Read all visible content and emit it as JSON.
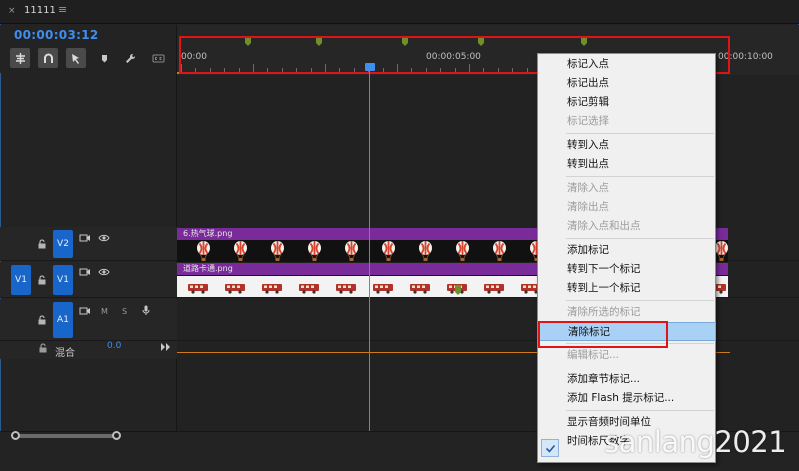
{
  "tab": {
    "close": "×",
    "title": "11111",
    "menu": "≡"
  },
  "timecode": "00:00:03:12",
  "ruler": {
    "labels": [
      "00:00",
      "00:00:05:00",
      "00:00:10:00"
    ]
  },
  "tracks": {
    "v2": {
      "name": "V2",
      "clip": "6.热气球.png"
    },
    "v1": {
      "source": "V1",
      "name": "V1",
      "clip": "道路卡通.png"
    },
    "a1": {
      "name": "A1",
      "mute": "M",
      "solo": "S"
    },
    "mix": {
      "label": "混合",
      "value": "0.0"
    }
  },
  "context_menu": {
    "items": [
      {
        "label": "标记入点",
        "enabled": true
      },
      {
        "label": "标记出点",
        "enabled": true
      },
      {
        "label": "标记剪辑",
        "enabled": true
      },
      {
        "label": "标记选择",
        "enabled": false
      },
      {
        "label": "转到入点",
        "enabled": true
      },
      {
        "label": "转到出点",
        "enabled": true
      },
      {
        "label": "清除入点",
        "enabled": false
      },
      {
        "label": "清除出点",
        "enabled": false
      },
      {
        "label": "清除入点和出点",
        "enabled": false
      },
      {
        "label": "添加标记",
        "enabled": true
      },
      {
        "label": "转到下一个标记",
        "enabled": true
      },
      {
        "label": "转到上一个标记",
        "enabled": true
      },
      {
        "label": "清除所选的标记",
        "enabled": false
      },
      {
        "label": "清除标记",
        "enabled": true
      },
      {
        "label": "编辑标记...",
        "enabled": false
      },
      {
        "label": "添加章节标记...",
        "enabled": true
      },
      {
        "label": "添加 Flash 提示标记...",
        "enabled": true
      },
      {
        "label": "显示音频时间单位",
        "enabled": true
      },
      {
        "label": "时间标尺数字",
        "enabled": true,
        "checked": true
      }
    ],
    "highlighted": "清除标记"
  },
  "watermark": "sanlang2021",
  "colors": {
    "accent": "#3d8ff0",
    "track_button": "#1866c9",
    "clip_title": "#7a2b9a",
    "annotation": "#e01414",
    "marker": "#6f8f2a",
    "menu_highlight": "#a9d0f5"
  }
}
